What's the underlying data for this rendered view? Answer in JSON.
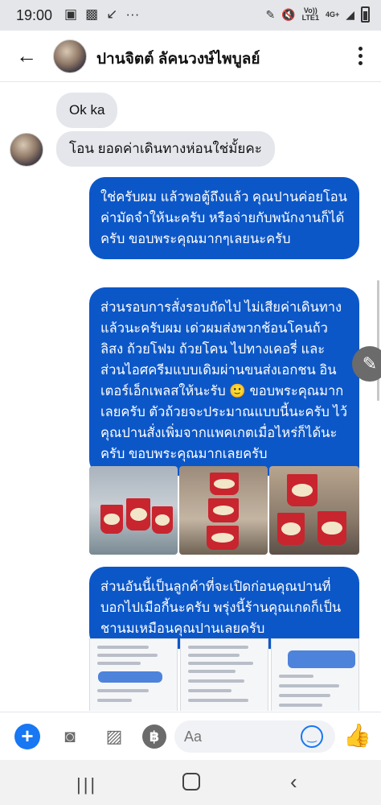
{
  "status_bar": {
    "time": "19:00",
    "left_icons": [
      "photo-icon",
      "gallery-icon",
      "missed-call-icon",
      "more-dots-icon"
    ],
    "network_label_top": "Vo)) LTE1",
    "network_label_right": "4G+",
    "network_label_bottom": "LTE1"
  },
  "header": {
    "contact_name": "ปานจิตต์ ลัคนวงษ์ไพบูลย์"
  },
  "messages": {
    "incoming": [
      {
        "text": "Ok ka"
      },
      {
        "text": "โอน ยอดค่าเดินทางห่อนใช่มั้ยคะ"
      }
    ],
    "outgoing": [
      {
        "text": "ใช่ครับผม แล้วพอตู้ถึงแล้ว คุณปานค่อยโอนค่ามัดจำให้นะครับ หรือจ่ายกับพนักงานก็ได้ครับ ขอบพระคุณมากๆเลยนะครับ"
      },
      {
        "text": "ส่วนรอบการสั่งรอบถัดไป ไม่เสียค่าเดินทางแล้วนะครับผม เด่วผมส่งพวกช้อนโคนถ้วลิสง ถ้วยโฟม ถ้วยโคน ไปทางเคอรี่ และส่วนไอศครีมแบบเดิมผ่านขนส่งเอกชน อินเตอร์เอ็กเพลสให้นะรับ 🙂 ขอบพระคุณมากเลยครับ ตัวถ้วยจะประมาณแบบนี้นะครับ ไว้คุณปานสั่งเพิ่มจากแพคเกตเมื่อไหร่ก็ได้นะครับ ขอบพระคุณมากเลยครับ"
      },
      {
        "text": "ส่วนอันนี้เป็นลูกค้าที่จะเปิดก่อนคุณปานที่บอกไปเมือกี้นะครับ พรุ่งนี้ร้านคุณเกดก็เป็นชานมเหมือนคุณปานเลยครับ"
      }
    ]
  },
  "composer": {
    "placeholder": "Aa"
  },
  "colors": {
    "outgoing_bubble": "#0c57c8",
    "incoming_bubble": "#e4e6eb",
    "accent": "#1877f2"
  }
}
